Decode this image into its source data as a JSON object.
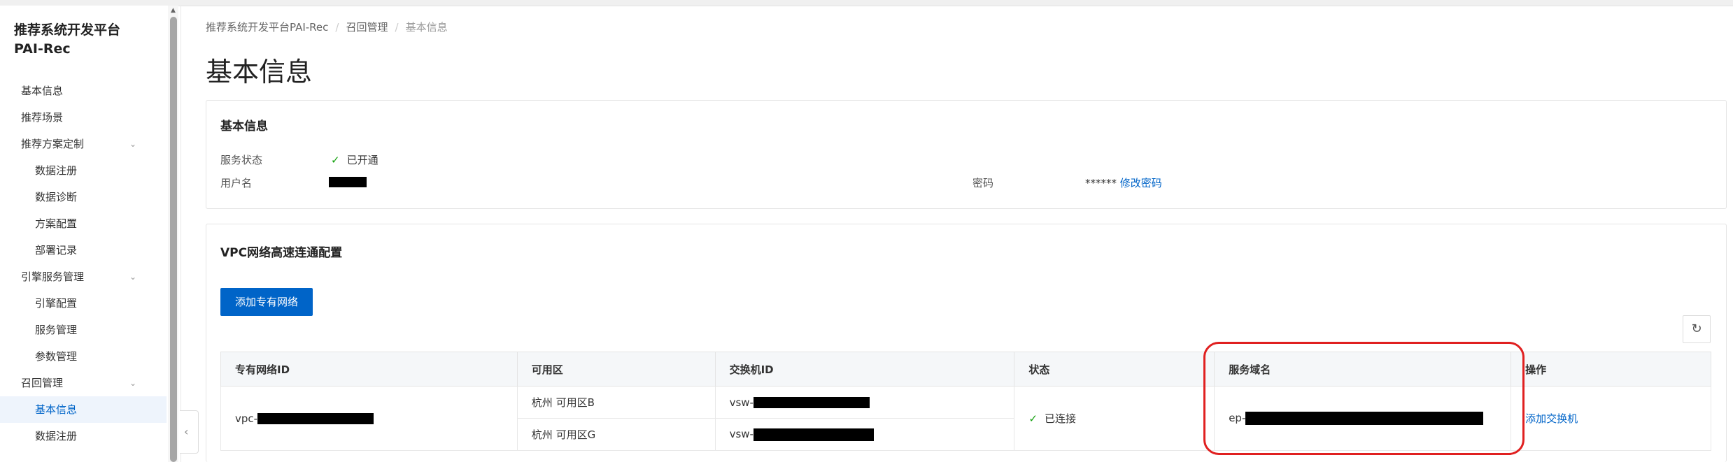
{
  "sidebar": {
    "title": "推荐系统开发平台PAI-Rec",
    "items": [
      {
        "label": "基本信息"
      },
      {
        "label": "推荐场景"
      },
      {
        "label": "推荐方案定制"
      },
      {
        "label": "数据注册"
      },
      {
        "label": "数据诊断"
      },
      {
        "label": "方案配置"
      },
      {
        "label": "部署记录"
      },
      {
        "label": "引擎服务管理"
      },
      {
        "label": "引擎配置"
      },
      {
        "label": "服务管理"
      },
      {
        "label": "参数管理"
      },
      {
        "label": "召回管理"
      },
      {
        "label": "基本信息"
      },
      {
        "label": "数据注册"
      }
    ]
  },
  "breadcrumb": [
    "推荐系统开发平台PAI-Rec",
    "召回管理",
    "基本信息"
  ],
  "page_title": "基本信息",
  "basic_info": {
    "title": "基本信息",
    "service_status_label": "服务状态",
    "service_status_value": "已开通",
    "username_label": "用户名",
    "password_label": "密码",
    "password_mask": "******",
    "change_password": "修改密码"
  },
  "vpc": {
    "title": "VPC网络高速连通配置",
    "add_button": "添加专有网络",
    "columns": [
      "专有网络ID",
      "可用区",
      "交换机ID",
      "状态",
      "服务域名",
      "操作"
    ],
    "row": {
      "vpc_prefix": "vpc-",
      "zone_1": "杭州 可用区B",
      "zone_2": "杭州 可用区G",
      "vsw_prefix_1": "vsw-",
      "vsw_prefix_2": "vsw-",
      "status": "已连接",
      "domain_prefix": "ep-",
      "action": "添加交换机"
    }
  },
  "colors": {
    "primary": "#0064c8",
    "success": "#13a10e",
    "highlight": "#e02020"
  }
}
